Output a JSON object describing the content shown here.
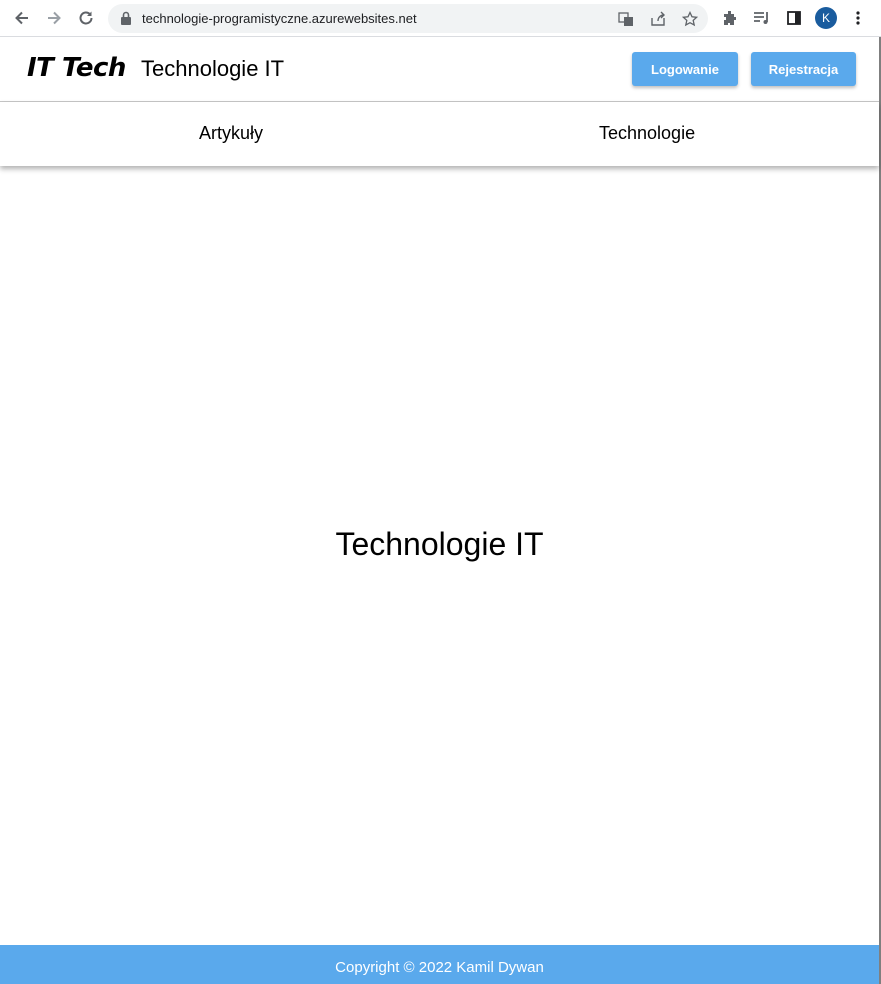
{
  "browser": {
    "url": "technologie-programistyczne.azurewebsites.net",
    "profile_initial": "K",
    "icons": [
      "back-icon",
      "forward-icon",
      "reload-icon",
      "lock-icon",
      "translate-icon",
      "share-icon",
      "star-icon",
      "extensions-icon",
      "media-icon",
      "side-panel-icon",
      "menu-icon"
    ]
  },
  "header": {
    "logo": "IT Tech",
    "title": "Technologie IT",
    "login_label": "Logowanie",
    "register_label": "Rejestracja"
  },
  "nav": {
    "items": [
      {
        "label": "Artykuły"
      },
      {
        "label": "Technologie"
      }
    ]
  },
  "main": {
    "title": "Technologie IT"
  },
  "footer": {
    "text": "Copyright © 2022 Kamil Dywan"
  },
  "colors": {
    "accent": "#5aa9ec",
    "avatar": "#1a5c9e"
  }
}
